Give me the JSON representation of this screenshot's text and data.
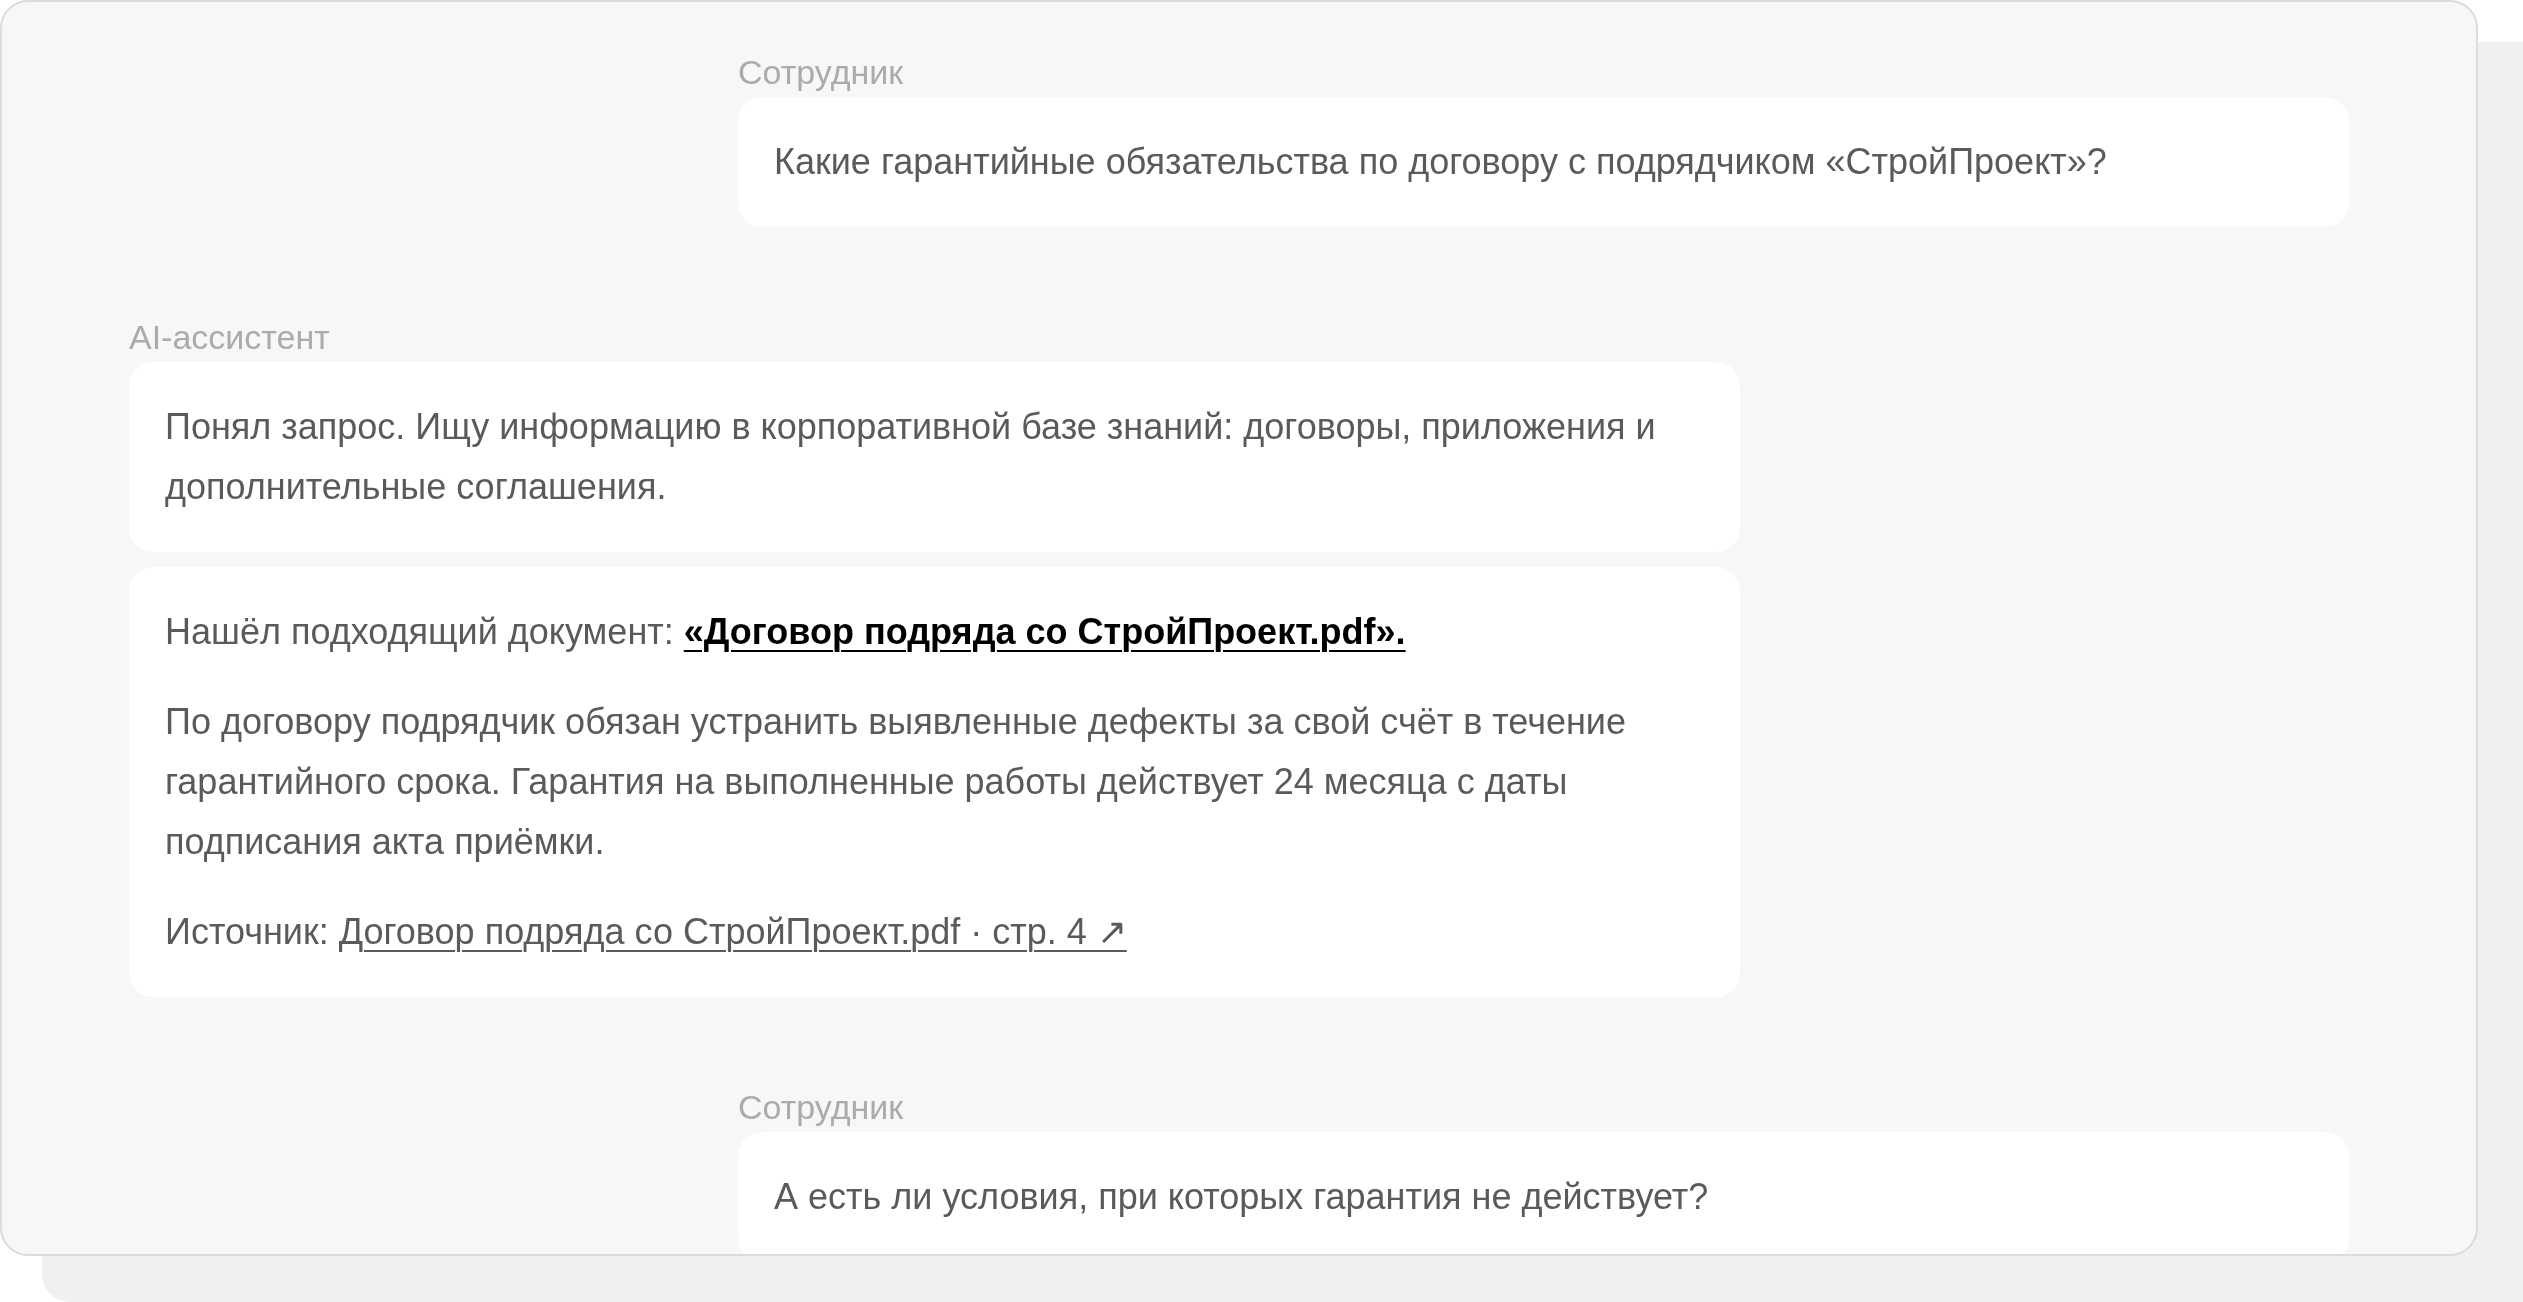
{
  "messages": [
    {
      "kind": "user",
      "author": "Сотрудник",
      "bubbles": [
        [
          {
            "kind": "plain",
            "text": "Какие гарантийные обязательства по договору с подрядчиком «СтройПроект»?"
          }
        ]
      ]
    },
    {
      "kind": "assistant",
      "author": "AI-ассистент",
      "bubbles": [
        [
          {
            "kind": "plain",
            "text": "Понял запрос. Ищу информацию в корпоративной базе знаний: договоры, приложения и дополнительные соглашения."
          }
        ],
        [
          {
            "kind": "link",
            "text": "Нашёл подходящий документ:",
            "link": "«Договор подряда со СтройПроект.pdf».",
            "emphasized": true
          },
          {
            "kind": "plain",
            "text": "По договору подрядчик обязан устранить выявленные дефекты за свой счёт в течение гарантийного срока. Гарантия на выполненные работы действует 24 месяца с даты подписания акта приёмки."
          },
          {
            "kind": "link",
            "text": "Источник:",
            "link": "Договор подряда со СтройПроект.pdf · стр. 4 ↗",
            "emphasized": false
          }
        ]
      ]
    },
    {
      "kind": "user",
      "author": "Сотрудник",
      "bubbles": [
        [
          {
            "kind": "plain",
            "text": "А есть ли условия, при которых гарантия не действует?"
          }
        ]
      ]
    }
  ]
}
